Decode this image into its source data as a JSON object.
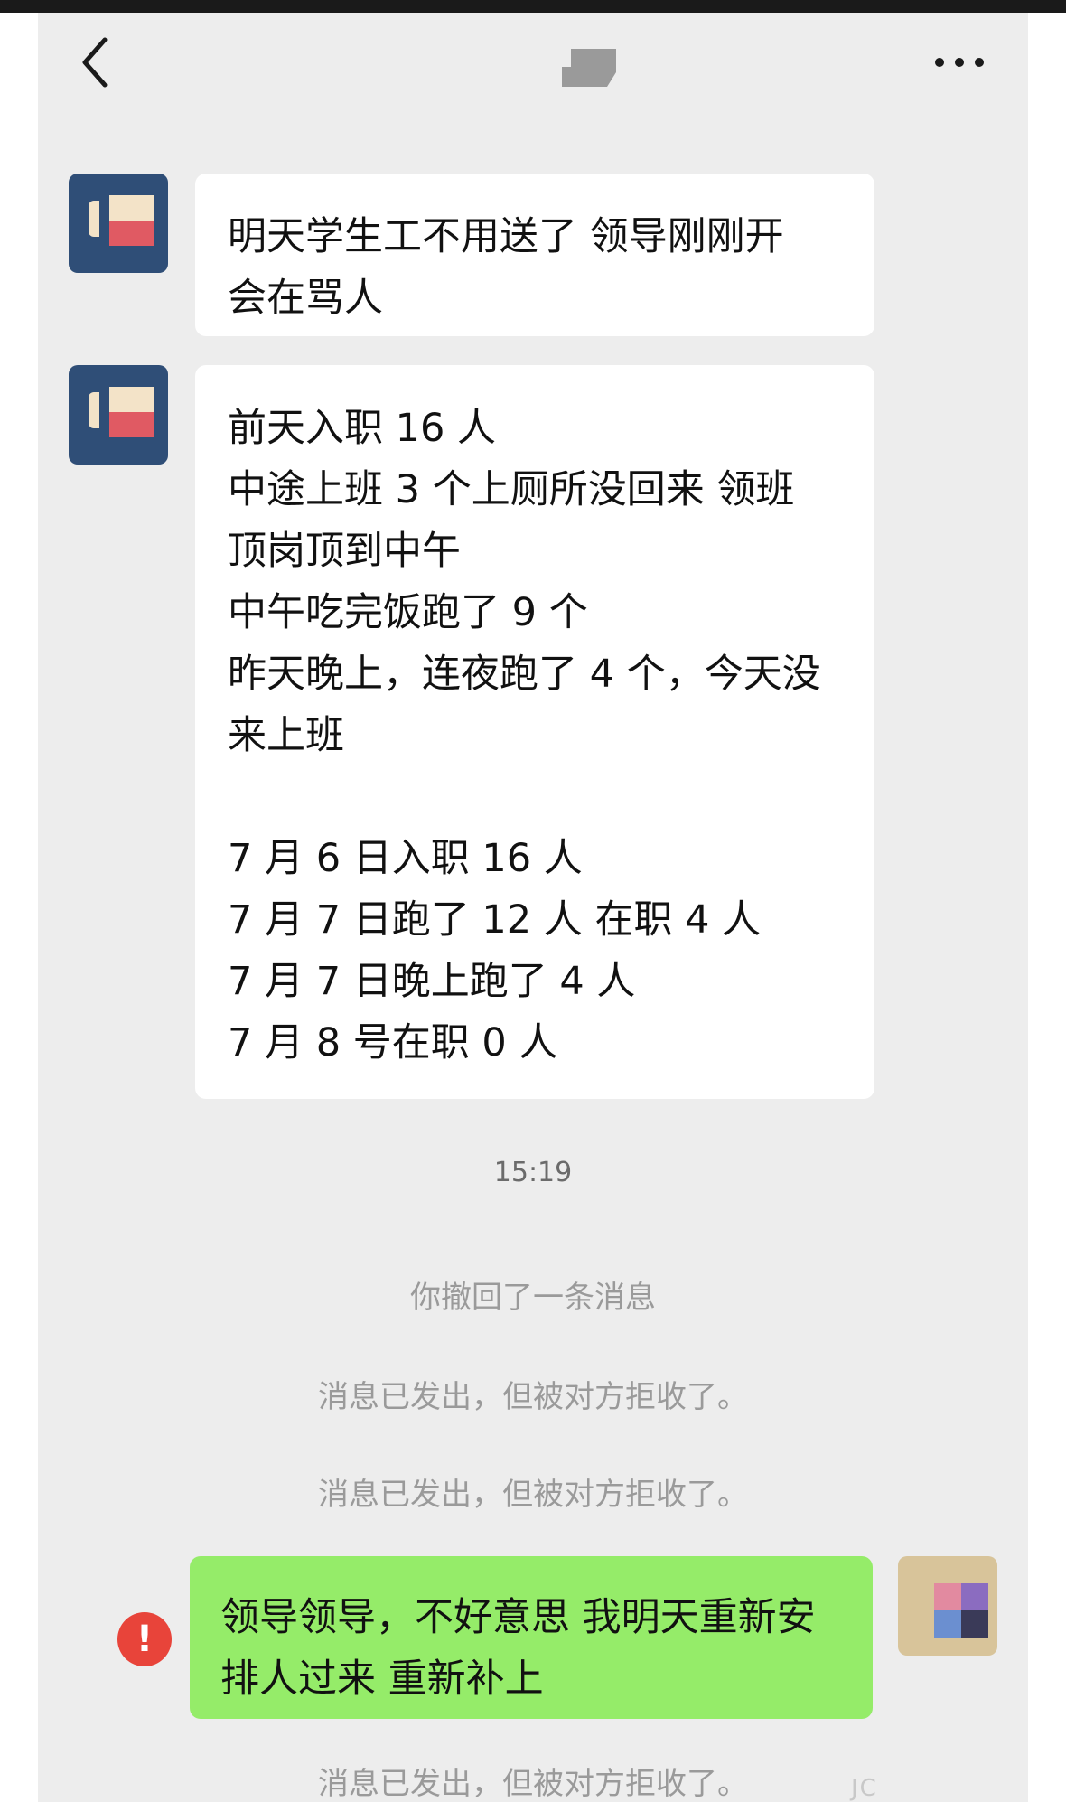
{
  "messages": {
    "m1": [
      "明天学生工不用送了 领导刚刚开",
      "会在骂人"
    ],
    "m2": [
      "前天入职 16 人",
      "中途上班 3 个上厕所没回来 领班",
      "顶岗顶到中午",
      "中午吃完饭跑了 9 个",
      "昨天晚上，连夜跑了 4 个，今天没",
      "来上班",
      "",
      "7 月 6 日入职 16 人",
      "7 月 7 日跑了 12 人 在职 4 人",
      "7 月 7 日晚上跑了 4 人",
      "7 月 8 号在职 0 人"
    ],
    "m3": [
      "领导领导，不好意思 我明天重新安",
      "排人过来 重新补上"
    ]
  },
  "system": {
    "time": "15:19",
    "recalled": "你撤回了一条消息",
    "rejected": "消息已发出，但被对方拒收了。"
  },
  "icons": {
    "back": "chevron-left-icon",
    "more": "more-dots-icon",
    "error": "error-icon"
  },
  "error_glyph": "!",
  "watermark": "JC",
  "colors": {
    "screen_bg": "#ededed",
    "incoming_bubble": "#ffffff",
    "outgoing_bubble": "#95ec69",
    "error": "#e8443a"
  }
}
